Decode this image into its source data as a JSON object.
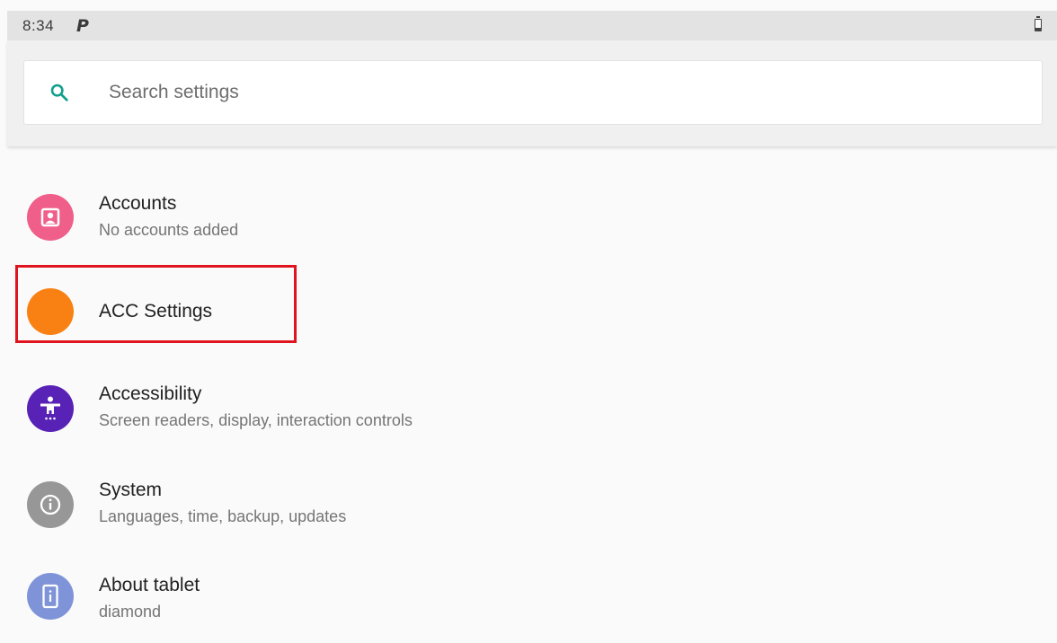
{
  "status_bar": {
    "time": "8:34",
    "notification_icon": "parking-p-icon",
    "battery_icon": "battery-icon"
  },
  "search": {
    "icon": "search-icon",
    "placeholder": "Search settings",
    "value": ""
  },
  "settings": {
    "items": [
      {
        "title": "Accounts",
        "summary": "No accounts added",
        "icon": "account-icon",
        "icon_color": "#ef5f8a"
      },
      {
        "title": "ACC Settings",
        "summary": "",
        "icon": "orange-circle-icon",
        "icon_color": "#f98113"
      },
      {
        "title": "Accessibility",
        "summary": "Screen readers, display, interaction controls",
        "icon": "accessibility-icon",
        "icon_color": "#5822b6"
      },
      {
        "title": "System",
        "summary": "Languages, time, backup, updates",
        "icon": "info-icon",
        "icon_color": "#979797"
      },
      {
        "title": "About tablet",
        "summary": "diamond",
        "icon": "tablet-info-icon",
        "icon_color": "#7f94d8"
      }
    ]
  },
  "highlight": {
    "target": "ACC Settings",
    "color": "#e0141e"
  }
}
